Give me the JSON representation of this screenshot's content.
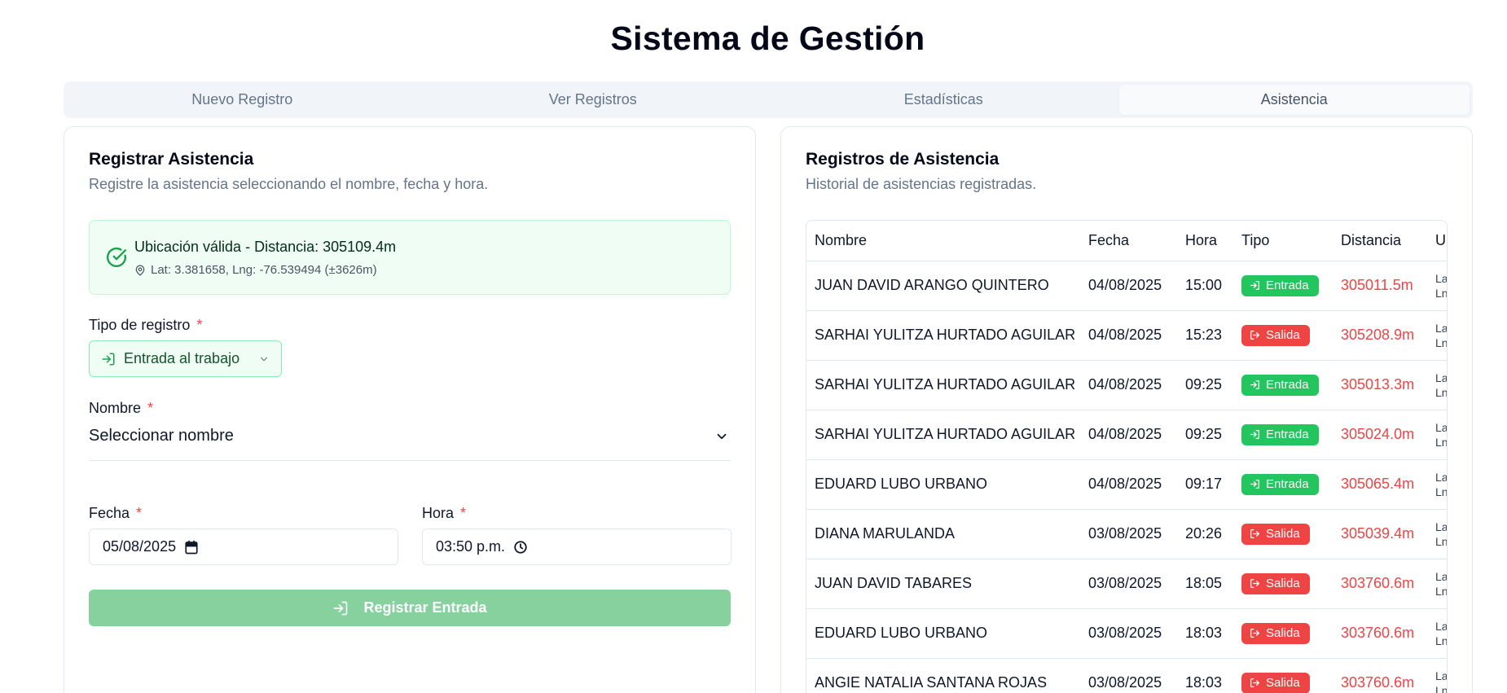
{
  "app": {
    "title": "Sistema de Gestión"
  },
  "tabs": [
    {
      "label": "Nuevo Registro"
    },
    {
      "label": "Ver Registros"
    },
    {
      "label": "Estadísticas"
    },
    {
      "label": "Asistencia",
      "active": true
    }
  ],
  "form": {
    "title": "Registrar Asistencia",
    "description": "Registre la asistencia seleccionando el nombre, fecha y hora.",
    "location": {
      "title": "Ubicación válida - Distancia: 305109.4m",
      "coords": "Lat: 3.381658, Lng: -76.539494 (±3626m)"
    },
    "type_label": "Tipo de registro",
    "type_value": "Entrada al trabajo",
    "name_label": "Nombre",
    "name_placeholder": "Seleccionar nombre",
    "date_label": "Fecha",
    "date_value": "05/08/2025",
    "time_label": "Hora",
    "time_value": "03:50 p.m.",
    "required_mark": "*",
    "submit_label": "Registrar Entrada"
  },
  "records": {
    "title": "Registros de Asistencia",
    "description": "Historial de asistencias registradas.",
    "columns": [
      "Nombre",
      "Fecha",
      "Hora",
      "Tipo",
      "Distancia",
      "U"
    ],
    "rows": [
      {
        "nombre": "JUAN DAVID ARANGO QUINTERO",
        "fecha": "04/08/2025",
        "hora": "15:00",
        "tipo": "Entrada",
        "distancia": "305011.5m",
        "ubicacion": "La\nLn"
      },
      {
        "nombre": "SARHAI YULITZA HURTADO AGUILAR",
        "fecha": "04/08/2025",
        "hora": "15:23",
        "tipo": "Salida",
        "distancia": "305208.9m",
        "ubicacion": "La\nLn"
      },
      {
        "nombre": "SARHAI YULITZA HURTADO AGUILAR",
        "fecha": "04/08/2025",
        "hora": "09:25",
        "tipo": "Entrada",
        "distancia": "305013.3m",
        "ubicacion": "La\nLn"
      },
      {
        "nombre": "SARHAI YULITZA HURTADO AGUILAR",
        "fecha": "04/08/2025",
        "hora": "09:25",
        "tipo": "Entrada",
        "distancia": "305024.0m",
        "ubicacion": "La\nLn"
      },
      {
        "nombre": "EDUARD LUBO URBANO",
        "fecha": "04/08/2025",
        "hora": "09:17",
        "tipo": "Entrada",
        "distancia": "305065.4m",
        "ubicacion": "La\nLn"
      },
      {
        "nombre": "DIANA MARULANDA",
        "fecha": "03/08/2025",
        "hora": "20:26",
        "tipo": "Salida",
        "distancia": "305039.4m",
        "ubicacion": "La\nLn"
      },
      {
        "nombre": "JUAN DAVID TABARES",
        "fecha": "03/08/2025",
        "hora": "18:05",
        "tipo": "Salida",
        "distancia": "303760.6m",
        "ubicacion": "La\nLn"
      },
      {
        "nombre": "EDUARD LUBO URBANO",
        "fecha": "03/08/2025",
        "hora": "18:03",
        "tipo": "Salida",
        "distancia": "303760.6m",
        "ubicacion": "La\nLn"
      },
      {
        "nombre": "ANGIE NATALIA SANTANA ROJAS",
        "fecha": "03/08/2025",
        "hora": "18:03",
        "tipo": "Salida",
        "distancia": "303760.6m",
        "ubicacion": "La\nLn"
      }
    ]
  },
  "colors": {
    "entrada": "#22c55e",
    "salida": "#ef4444",
    "distance": "#ef4444",
    "location_bg": "#f0fdf4"
  },
  "icons": {
    "location_ok": "check-circle-icon",
    "pin": "map-pin-icon",
    "entrada": "log-in-icon",
    "salida": "log-out-icon",
    "dropdown": "chevron-down-icon",
    "calendar": "calendar-icon",
    "clock": "clock-icon"
  }
}
